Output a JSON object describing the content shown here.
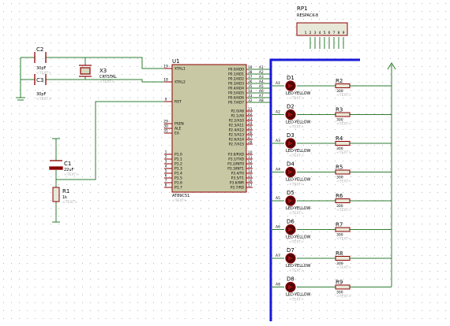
{
  "colors": {
    "background": "#ffffff",
    "grid_dot": "#b7b7b7",
    "wire": "#2e7d32",
    "component": "#8b0000",
    "ic_fill": "#c8c8a4",
    "bus": "#1a1ad9",
    "led_fill": "#4a0808",
    "text": "#000000",
    "faint_text": "#b0b0b0"
  },
  "rp1": {
    "ref": "RP1",
    "value": "RESPACK-8",
    "pins": [
      "1",
      "2",
      "3",
      "4",
      "5",
      "6",
      "7",
      "8",
      "9"
    ]
  },
  "caps": [
    {
      "ref": "C2",
      "value": "30pF",
      "faint": "<TEXT>"
    },
    {
      "ref": "C3",
      "value": "30pF",
      "faint": "<TEXT>"
    },
    {
      "ref": "C1",
      "value": "22uF",
      "faint": "<TEXT>"
    }
  ],
  "crystal": {
    "ref": "X3",
    "value": "CRYSTAL",
    "faint": "<TEXT>"
  },
  "r1": {
    "ref": "R1",
    "value": "1k",
    "faint": "<TEXT>"
  },
  "u1": {
    "ref": "U1",
    "part": "AT89C51",
    "faint": "<TEXT>",
    "left_pins": [
      {
        "num": "19",
        "name": "XTAL1"
      },
      {
        "num": "18",
        "name": "XTAL2"
      },
      {
        "num": "9",
        "name": "RST"
      },
      {
        "num": "29",
        "name": "PSEN"
      },
      {
        "num": "30",
        "name": "ALE"
      },
      {
        "num": "31",
        "name": "EA"
      },
      {
        "num": "1",
        "name": "P1.0"
      },
      {
        "num": "2",
        "name": "P1.1"
      },
      {
        "num": "3",
        "name": "P1.2"
      },
      {
        "num": "4",
        "name": "P1.3"
      },
      {
        "num": "5",
        "name": "P1.4"
      },
      {
        "num": "6",
        "name": "P1.5"
      },
      {
        "num": "7",
        "name": "P1.6"
      },
      {
        "num": "8",
        "name": "P1.7"
      }
    ],
    "port0": [
      {
        "num": "39",
        "name": "P0.0/AD0",
        "net": "A1"
      },
      {
        "num": "38",
        "name": "P0.1/AD1",
        "net": "A2"
      },
      {
        "num": "37",
        "name": "P0.2/AD2",
        "net": "A3"
      },
      {
        "num": "36",
        "name": "P0.3/AD3",
        "net": "A4"
      },
      {
        "num": "35",
        "name": "P0.4/AD4",
        "net": "A5"
      },
      {
        "num": "34",
        "name": "P0.5/AD5",
        "net": "A6"
      },
      {
        "num": "33",
        "name": "P0.6/AD6",
        "net": "A7"
      },
      {
        "num": "32",
        "name": "P0.7/AD7",
        "net": "A8"
      }
    ],
    "port2": [
      {
        "num": "21",
        "name": "P2.0/A8"
      },
      {
        "num": "22",
        "name": "P2.1/A9"
      },
      {
        "num": "23",
        "name": "P2.2/A10"
      },
      {
        "num": "24",
        "name": "P2.3/A11"
      },
      {
        "num": "25",
        "name": "P2.4/A12"
      },
      {
        "num": "26",
        "name": "P2.5/A13"
      },
      {
        "num": "27",
        "name": "P2.6/A14"
      },
      {
        "num": "28",
        "name": "P2.7/A15"
      }
    ],
    "port3": [
      {
        "num": "10",
        "name": "P3.0/RXD"
      },
      {
        "num": "11",
        "name": "P3.1/TXD"
      },
      {
        "num": "12",
        "name": "P3.2/INT0"
      },
      {
        "num": "13",
        "name": "P3.3/INT1"
      },
      {
        "num": "14",
        "name": "P3.4/T0"
      },
      {
        "num": "15",
        "name": "P3.5/T1"
      },
      {
        "num": "16",
        "name": "P3.6/WR"
      },
      {
        "num": "17",
        "name": "P3.7/RD"
      }
    ]
  },
  "leds": [
    {
      "ref": "D1",
      "net": "A1",
      "value": "LED-YELLOW",
      "faint": "<TEXT>",
      "r_ref": "R2",
      "r_val": "300",
      "r_faint": "<TEXT>"
    },
    {
      "ref": "D2",
      "net": "A2",
      "value": "LED-YELLOW",
      "faint": "<TEXT>",
      "r_ref": "R3",
      "r_val": "300",
      "r_faint": "<TEXT>"
    },
    {
      "ref": "D3",
      "net": "A3",
      "value": "LED-YELLOW",
      "faint": "<TEXT>",
      "r_ref": "R4",
      "r_val": "300",
      "r_faint": "<TEXT>"
    },
    {
      "ref": "D4",
      "net": "A4",
      "value": "LED-YELLOW",
      "faint": "<TEXT>",
      "r_ref": "R5",
      "r_val": "300",
      "r_faint": "<TEXT>"
    },
    {
      "ref": "D5",
      "net": "A5",
      "value": "LED-YELLOW",
      "faint": "<TEXT>",
      "r_ref": "R6",
      "r_val": "300",
      "r_faint": "<TEXT>"
    },
    {
      "ref": "D6",
      "net": "A6",
      "value": "LED-YELLOW",
      "faint": "<TEXT>",
      "r_ref": "R7",
      "r_val": "300",
      "r_faint": "<TEXT>"
    },
    {
      "ref": "D7",
      "net": "A7",
      "value": "LED-YELLOW",
      "faint": "<TEXT>",
      "r_ref": "R8",
      "r_val": "300",
      "r_faint": "<TEXT>"
    },
    {
      "ref": "D8",
      "net": "A8",
      "value": "LED-YELLOW",
      "faint": "<TEXT>",
      "r_ref": "R9",
      "r_val": "300",
      "r_faint": "<TEXT>"
    }
  ]
}
